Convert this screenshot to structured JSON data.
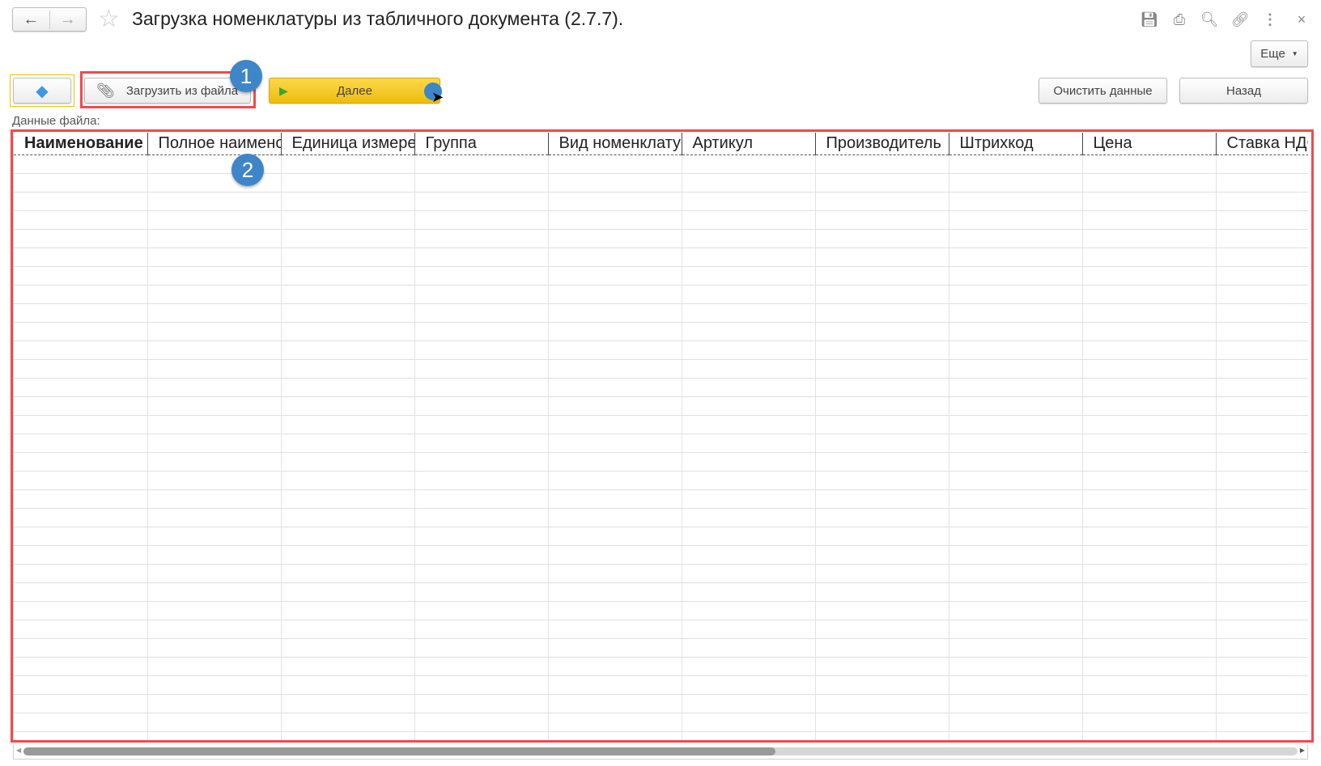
{
  "window": {
    "title": "Загрузка номенклатуры из табличного документа (2.7.7).",
    "back_icon": "←",
    "forward_icon": "→"
  },
  "toolbar_icons": [
    "save-icon",
    "print-icon",
    "preview-icon",
    "link-icon",
    "more-icon",
    "close-icon"
  ],
  "buttons": {
    "more": "Еще",
    "load_file": "Загрузить из файла",
    "next": "Далее",
    "clear": "Очистить данные",
    "back": "Назад"
  },
  "file_data_label": "Данные файла:",
  "annotations": [
    "1",
    "2"
  ],
  "table": {
    "columns": [
      "Наименование",
      "Полное наименование",
      "Единица измерения",
      "Группа",
      "Вид номенклатуры",
      "Артикул",
      "Производитель",
      "Штрихкод",
      "Цена",
      "Ставка НДС"
    ]
  },
  "scrollbar": {
    "horizontal_position": 0.0,
    "visible_fraction": 0.59
  },
  "colors": {
    "accent_yellow": "#f5c816",
    "highlight_red": "#f04a4f",
    "badge_blue": "#3f86c9"
  }
}
